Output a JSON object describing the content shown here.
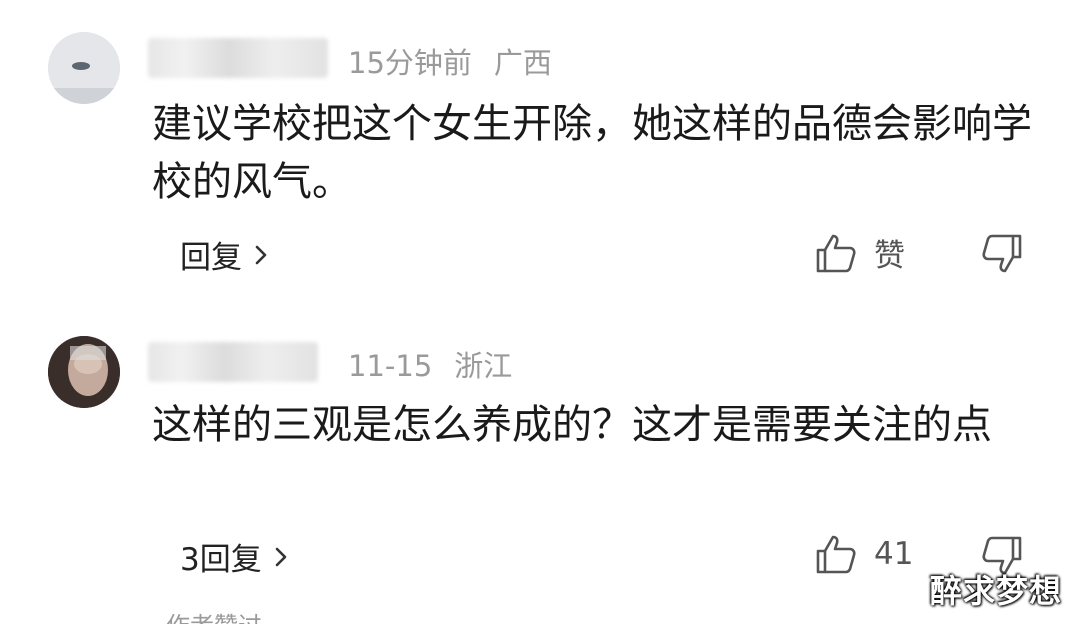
{
  "comments": [
    {
      "time": "15分钟前",
      "region": "广西",
      "text": "建议学校把这个女生开除，她这样的品德会影响学校的风气。",
      "reply_label": "回复",
      "like_label": "赞",
      "avatar_icon": "avatar",
      "like_icon": "thumbs-up-icon",
      "dislike_icon": "thumbs-down-icon"
    },
    {
      "time": "11-15",
      "region": "浙江",
      "text": "这样的三观是怎么养成的？这才是需要关注的点",
      "reply_label": "3回复",
      "like_label": "41",
      "avatar_icon": "avatar",
      "like_icon": "thumbs-up-icon",
      "dislike_icon": "thumbs-down-icon"
    }
  ],
  "footer_tag": "作者赞过",
  "watermark": "醉求梦想",
  "colors": {
    "text": "#1a1a1a",
    "meta": "#9a9a9a",
    "background": "#ffffff"
  }
}
